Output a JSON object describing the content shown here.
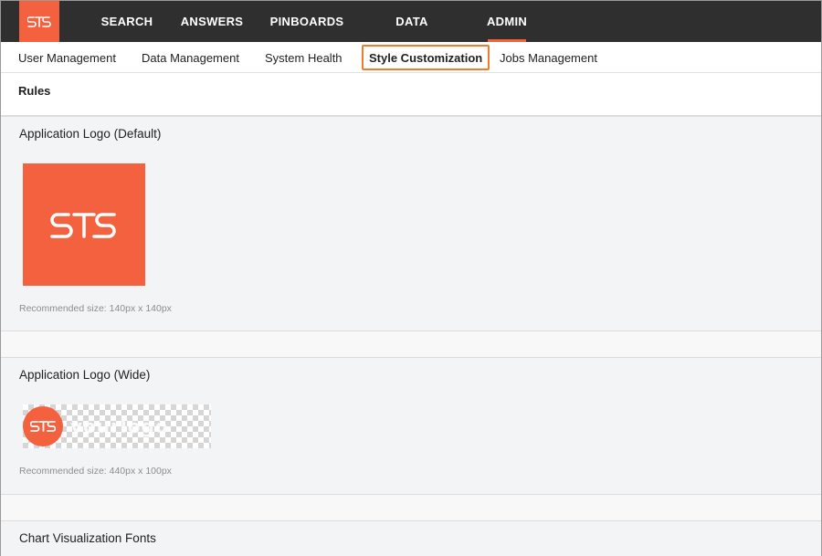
{
  "topbar": {
    "logo_icon": "sts-logo-icon",
    "items": [
      {
        "label": "SEARCH"
      },
      {
        "label": "ANSWERS"
      },
      {
        "label": "PINBOARDS"
      },
      {
        "label": "DATA"
      },
      {
        "label": "ADMIN",
        "active": true
      }
    ],
    "brand_color": "#f4613f",
    "background": "#2f2f2f"
  },
  "subtabs": {
    "items": [
      {
        "label": "User Management"
      },
      {
        "label": "Data Management"
      },
      {
        "label": "System Health"
      },
      {
        "label": "Style Customization",
        "active": true
      },
      {
        "label": "Jobs Management"
      }
    ],
    "highlight_color": "#ef7d2b"
  },
  "rules": {
    "label": "Rules"
  },
  "sections": {
    "logo_default": {
      "title": "Application Logo (Default)",
      "recommended": "Recommended size: 140px x 140px"
    },
    "logo_wide": {
      "title": "Application Logo (Wide)",
      "recommended": "Recommended size: 440px x 100px",
      "wordmark": "yourlogo"
    },
    "chart_fonts": {
      "title": "Chart Visualization Fonts"
    }
  }
}
